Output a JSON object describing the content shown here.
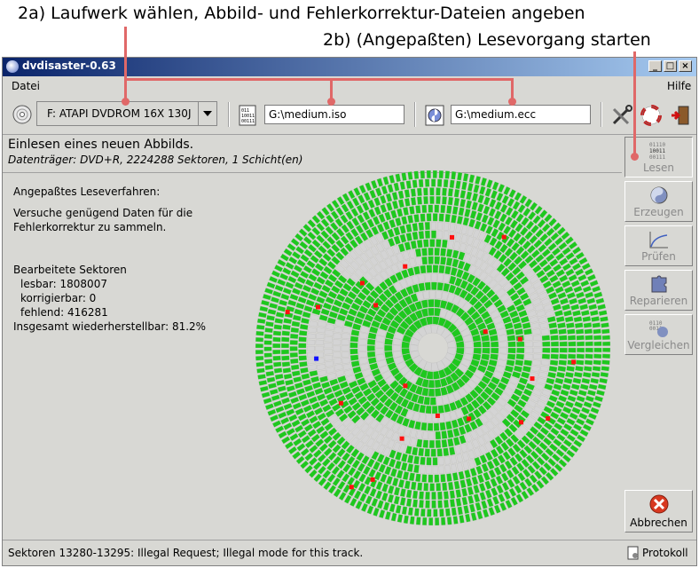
{
  "annotations": {
    "line1": "2a) Laufwerk wählen, Abbild- und Fehlerkorrektur-Dateien angeben",
    "line2": "2b) (Angepaßten) Lesevorgang starten"
  },
  "window": {
    "title": "dvdisaster-0.63",
    "min": "_",
    "max": "□",
    "close": "×"
  },
  "menu": {
    "file": "Datei",
    "help": "Hilfe"
  },
  "toolbar": {
    "drive": "F: ATAPI DVDROM 16X 130J",
    "image_file": "G:\\medium.iso",
    "ecc_file": "G:\\medium.ecc"
  },
  "header": {
    "title": "Einlesen eines neuen Abbilds.",
    "subtitle": "Datenträger: DVD+R, 2224288 Sektoren, 1 Schicht(en)"
  },
  "stats": {
    "method": "Angepaßtes Leseverfahren:",
    "desc1": "Versuche genügend Daten für die",
    "desc2": "Fehlerkorrektur zu sammeln.",
    "processed": "Bearbeitete Sektoren",
    "readable": "lesbar: 1808007",
    "correctable": "korrigierbar: 0",
    "missing": "fehlend: 416281",
    "total": "Insgesamt wiederherstellbar: 81.2%"
  },
  "sidebar": {
    "read": "Lesen",
    "create": "Erzeugen",
    "verify": "Prüfen",
    "repair": "Reparieren",
    "compare": "Vergleichen",
    "cancel": "Abbrechen"
  },
  "status": {
    "message": "Sektoren 13280-13295: Illegal Request; Illegal mode for this track.",
    "log": "Protokoll"
  },
  "colors": {
    "good": "#1ec81e",
    "missing": "#d4d4d4",
    "error": "#ff1010",
    "current": "#1010ff",
    "annotation": "#e06868",
    "titlebar": "#0a246a"
  },
  "spiral_status": [
    "good",
    "good",
    "good",
    "good",
    "good",
    "good",
    "mixed",
    "mixed",
    "mixed",
    "mixed",
    "mixed",
    "good",
    "mixed",
    "good",
    "mixed",
    "good",
    "mixed",
    "good",
    "missing"
  ]
}
